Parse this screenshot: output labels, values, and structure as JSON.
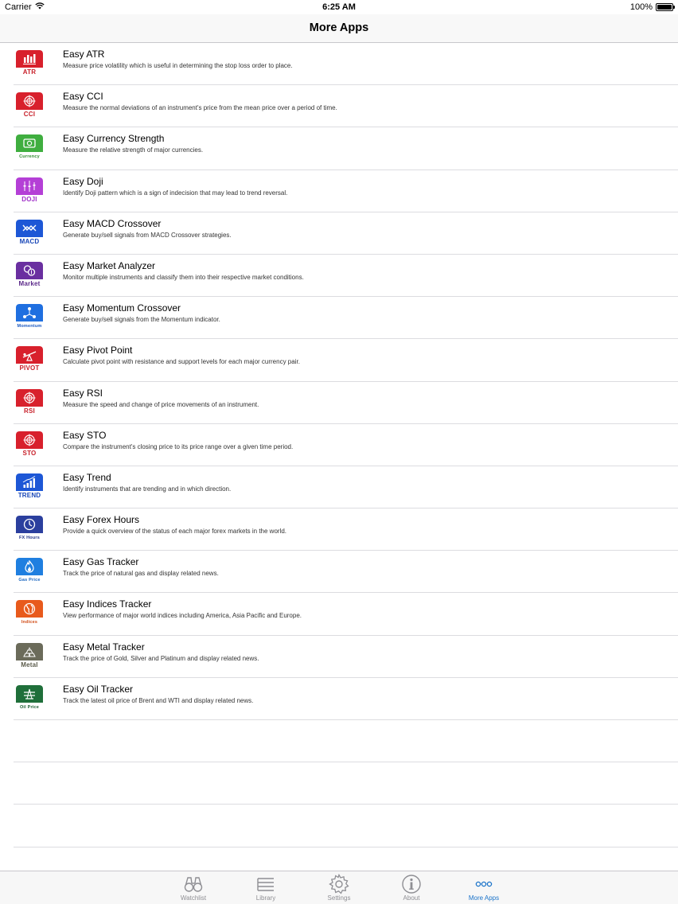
{
  "status": {
    "carrier": "Carrier",
    "time": "6:25 AM",
    "battery": "100%",
    "battery_level": 1.0
  },
  "nav": {
    "title": "More Apps"
  },
  "apps": [
    {
      "title": "Easy ATR",
      "desc": "Measure price volatility which is useful in determining the stop loss order to place.",
      "caption": "ATR",
      "icon": "candlestick-chart-icon",
      "color": "#d8202c",
      "caption_color": "#c8202a"
    },
    {
      "title": "Easy CCI",
      "desc": "Measure the normal deviations of an instrument's price from the mean price over a period of time.",
      "caption": "CCI",
      "icon": "target-icon",
      "color": "#d8202c",
      "caption_color": "#c8202a"
    },
    {
      "title": "Easy Currency Strength",
      "desc": "Measure the relative strength of major currencies.",
      "caption": "Currency",
      "icon": "banknote-icon",
      "color": "#3fae3f",
      "caption_color": "#2e8b2e"
    },
    {
      "title": "Easy Doji",
      "desc": "Identify Doji pattern which is a sign of indecision that may lead to trend reversal.",
      "caption": "DOJI",
      "icon": "doji-candles-icon",
      "color": "#b43fd6",
      "caption_color": "#a030c8"
    },
    {
      "title": "Easy MACD Crossover",
      "desc": "Generate buy/sell signals from MACD Crossover strategies.",
      "caption": "MACD",
      "icon": "crossover-lines-icon",
      "color": "#1d57d6",
      "caption_color": "#1a48b8"
    },
    {
      "title": "Easy Market Analyzer",
      "desc": "Monitor multiple instruments and classify them into their respective market conditions.",
      "caption": "Market",
      "icon": "coins-icon",
      "color": "#6a2fa0",
      "caption_color": "#5c2a8a"
    },
    {
      "title": "Easy Momentum Crossover",
      "desc": "Generate buy/sell signals from the Momentum indicator.",
      "caption": "Momentum",
      "icon": "network-nodes-icon",
      "color": "#1f6fe0",
      "caption_color": "#1a58c0"
    },
    {
      "title": "Easy Pivot Point",
      "desc": "Calculate pivot point with resistance and support levels for each major currency pair.",
      "caption": "PIVOT",
      "icon": "seesaw-icon",
      "color": "#d8202c",
      "caption_color": "#c8202a"
    },
    {
      "title": "Easy RSI",
      "desc": "Measure the speed and change of price movements of an instrument.",
      "caption": "RSI",
      "icon": "target-icon",
      "color": "#d8202c",
      "caption_color": "#c8202a"
    },
    {
      "title": "Easy STO",
      "desc": "Compare the instrument's closing price to its price range over a given time period.",
      "caption": "STO",
      "icon": "target-icon",
      "color": "#d8202c",
      "caption_color": "#c8202a"
    },
    {
      "title": "Easy Trend",
      "desc": "Identify instruments that are trending and in which direction.",
      "caption": "TREND",
      "icon": "rising-bars-icon",
      "color": "#1d57d6",
      "caption_color": "#1a48b8"
    },
    {
      "title": "Easy Forex Hours",
      "desc": "Provide a quick overview of the status of each major forex markets in the world.",
      "caption": "FX Hours",
      "icon": "clock-icon",
      "color": "#2b3f9e",
      "caption_color": "#243688"
    },
    {
      "title": "Easy Gas Tracker",
      "desc": "Track the price of natural gas and display related news.",
      "caption": "Gas Price",
      "icon": "flame-icon",
      "color": "#1f7fe0",
      "caption_color": "#1a66c0"
    },
    {
      "title": "Easy Indices Tracker",
      "desc": "View performance of major world indices including America, Asia Pacific and Europe.",
      "caption": "Indices",
      "icon": "globe-icon",
      "color": "#e85a1c",
      "caption_color": "#d04a14"
    },
    {
      "title": "Easy Metal Tracker",
      "desc": "Track the price of Gold, Silver and Platinum and display related news.",
      "caption": "Metal",
      "icon": "gold-bars-icon",
      "color": "#6b6b5a",
      "caption_color": "#5a5a4a"
    },
    {
      "title": "Easy Oil Tracker",
      "desc": "Track the latest oil price of Brent and WTI and display related news.",
      "caption": "Oil Price",
      "icon": "oil-rig-icon",
      "color": "#1f6f3a",
      "caption_color": "#1b5e31"
    }
  ],
  "tabs": [
    {
      "label": "Watchlist",
      "icon": "binoculars-icon",
      "active": false
    },
    {
      "label": "Library",
      "icon": "list-icon",
      "active": false
    },
    {
      "label": "Settings",
      "icon": "gear-icon",
      "active": false
    },
    {
      "label": "About",
      "icon": "info-icon",
      "active": false
    },
    {
      "label": "More Apps",
      "icon": "more-dots-icon",
      "active": true
    }
  ],
  "colors": {
    "active_tab": "#1a73c9",
    "inactive_tab": "#8e8e93",
    "separator": "#dcdce0"
  }
}
